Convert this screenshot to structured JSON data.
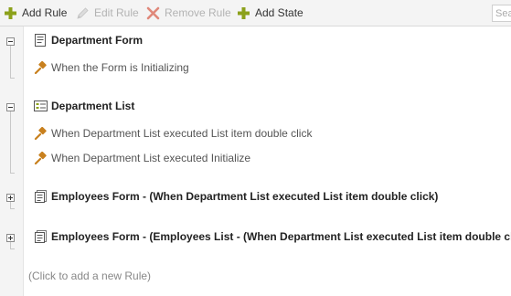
{
  "toolbar": {
    "add_rule": {
      "label": "Add Rule",
      "icon": "plus-icon",
      "color": "#8ca11b"
    },
    "edit_rule": {
      "label": "Edit Rule",
      "icon": "pencil-icon"
    },
    "remove_rule": {
      "label": "Remove Rule",
      "icon": "x-icon",
      "color": "#e0887a"
    },
    "add_state": {
      "label": "Add State",
      "icon": "plus-icon",
      "color": "#8ca11b"
    },
    "search": {
      "placeholder": "Sea"
    }
  },
  "tree": {
    "states": [
      {
        "title": "Department Form",
        "icon": "form-icon",
        "expanded": true,
        "events": [
          {
            "label": "When the Form is Initializing",
            "icon": "gavel-icon"
          }
        ]
      },
      {
        "title": "Department List",
        "icon": "list-icon",
        "expanded": true,
        "events": [
          {
            "label": "When Department List executed List item double click",
            "icon": "gavel-icon"
          },
          {
            "label": "When Department List executed Initialize",
            "icon": "gavel-icon"
          }
        ]
      },
      {
        "title": "Employees Form - (When Department List executed List item double click)",
        "icon": "subform-icon",
        "expanded": false,
        "events": []
      },
      {
        "title": "Employees Form - (Employees List - (When Department List executed List item double click))",
        "icon": "subform-icon",
        "expanded": false,
        "events": []
      }
    ],
    "add_rule_hint": "(Click to add a new Rule)"
  },
  "colors": {
    "accent_green": "#8ca11b",
    "gavel": "#c8801e",
    "remove_red": "#e0887a",
    "toolbar_bg": "#f4f4f4"
  }
}
